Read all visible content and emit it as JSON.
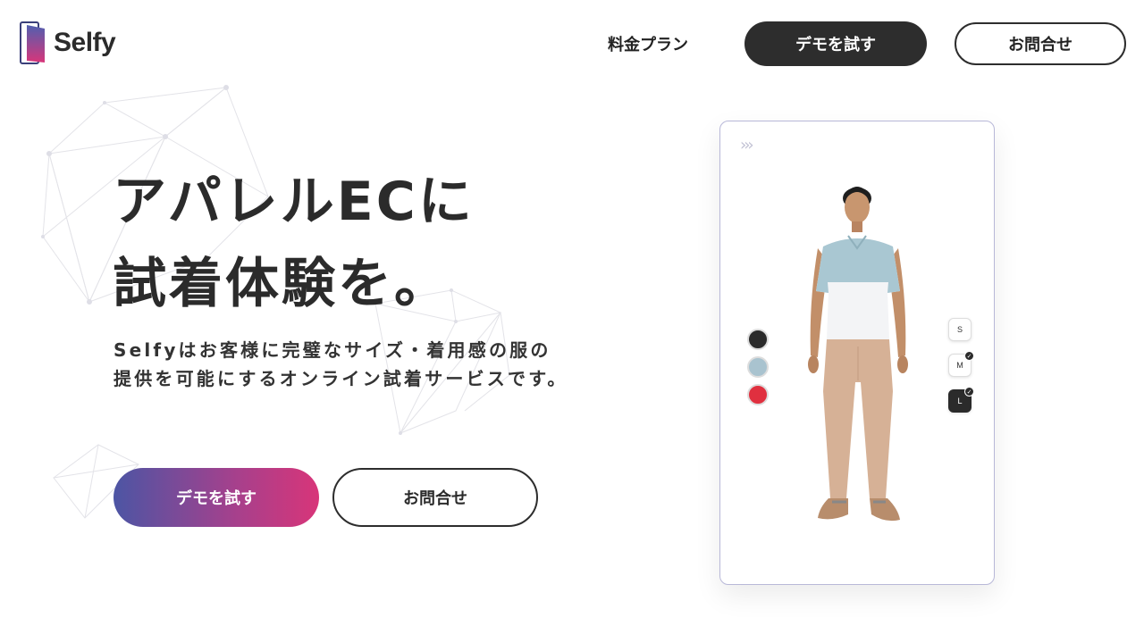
{
  "header": {
    "logo_text": "Selfy",
    "nav_pricing": "料金プラン",
    "nav_demo": "デモを試す",
    "nav_contact": "お問合せ"
  },
  "hero": {
    "title_line1": "アパレルECに",
    "title_line2": "試着体験を。",
    "desc_line1": "Selfyはお客様に完璧なサイズ・着用感の服の",
    "desc_line2": "提供を可能にするオンライン試着サービスです。",
    "cta_demo": "デモを試す",
    "cta_contact": "お問合せ"
  },
  "tryon": {
    "colors": [
      "#2b2b2b",
      "#a9c3cf",
      "#e0303f"
    ],
    "sizes": [
      {
        "label": "S",
        "checked": false,
        "selected": false
      },
      {
        "label": "M",
        "checked": true,
        "selected": false
      },
      {
        "label": "L",
        "checked": true,
        "selected": true
      }
    ]
  },
  "theme": {
    "dark": "#2d2d2d",
    "gradient_start": "#4c55a4",
    "gradient_end": "#d83579"
  }
}
